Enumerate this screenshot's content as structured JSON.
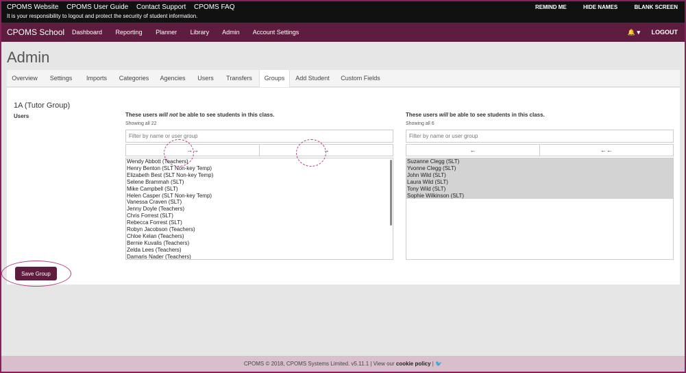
{
  "topbar": {
    "links": [
      "CPOMS Website",
      "CPOMS User Guide",
      "Contact Support",
      "CPOMS FAQ"
    ],
    "note": "It is your responsibility to logout and protect the security of student information.",
    "right": [
      "REMIND ME",
      "HIDE NAMES",
      "BLANK SCREEN"
    ]
  },
  "nav": {
    "brand": "CPOMS School",
    "items": [
      "Dashboard",
      "Reporting",
      "Planner",
      "Library",
      "Admin",
      "Account Settings"
    ],
    "bell": "🔔 ▾",
    "logout": "LOGOUT"
  },
  "page_title": "Admin",
  "tabs": [
    "Overview",
    "Settings",
    "Imports",
    "Categories",
    "Agencies",
    "Users",
    "Transfers",
    "Groups",
    "Add Student",
    "Custom Fields"
  ],
  "active_tab": "Groups",
  "group": {
    "title": "1A (Tutor Group)",
    "users_label": "Users"
  },
  "left_col": {
    "heading_pre": "These users ",
    "heading_em": "will not",
    "heading_post": " be able to see students in this class.",
    "count": "Showing all 22",
    "filter_placeholder": "Filter by name or user group",
    "btn_move_all": "→→",
    "btn_move": "→",
    "items": [
      "Wendy Abbott (Teachers)",
      "Henry Benton (SLT Non-key Temp)",
      "Elizabeth Best (SLT Non-key Temp)",
      "Selene Brammah (SLT)",
      "Mike Campbell (SLT)",
      "Helen Casper (SLT Non-key Temp)",
      "Vanessa Craven (SLT)",
      "Jenny Doyle (Teachers)",
      "Chris Forrest (SLT)",
      "Rebecca Forrest (SLT)",
      "Robyn Jacobson (Teachers)",
      "Chloe Kelan (Teachers)",
      "Bernie Kuvalis (Teachers)",
      "Zelda Lees (Teachers)",
      "Damaris Nader (Teachers)"
    ]
  },
  "right_col": {
    "heading_pre": "These users ",
    "heading_em": "will",
    "heading_post": " be able to see students in this class.",
    "count": "Showing all 6",
    "filter_placeholder": "Filter by name or user group",
    "btn_remove": "←",
    "btn_remove_all": "←←",
    "items": [
      "Suzanne Clegg (SLT)",
      "Yvonne Clegg (SLT)",
      "John Wild (SLT)",
      "Laura Wild (SLT)",
      "Tony Wild (SLT)",
      "Sophie Wilkinson (SLT)"
    ]
  },
  "save_label": "Save Group",
  "footer": {
    "text": "CPOMS © 2018, CPOMS Systems Limited. v5.11.1 | View our ",
    "link": "cookie policy",
    "sep": " | "
  },
  "colors": {
    "brand": "#5e1c3f",
    "topbar": "#111111",
    "annotation": "#b03c84",
    "footer_bg": "#d9bfcb"
  }
}
